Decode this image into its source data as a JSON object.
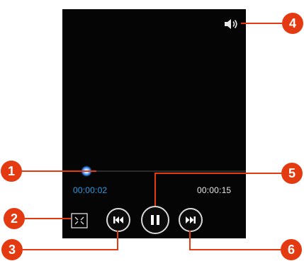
{
  "player": {
    "elapsed_time": "00:00:02",
    "total_time": "00:00:15",
    "progress_fraction": 0.13,
    "volume_icon": "speaker-icon",
    "fit_icon": "fit-screen-icon",
    "controls": {
      "previous_icon": "skip-previous-icon",
      "pause_icon": "pause-icon",
      "next_icon": "skip-next-icon"
    }
  },
  "callouts": {
    "c1": "1",
    "c2": "2",
    "c3": "3",
    "c4": "4",
    "c5": "5",
    "c6": "6"
  },
  "colors": {
    "screen": "#050505",
    "accent": "#2e9be6",
    "callout": "#e43a12"
  }
}
